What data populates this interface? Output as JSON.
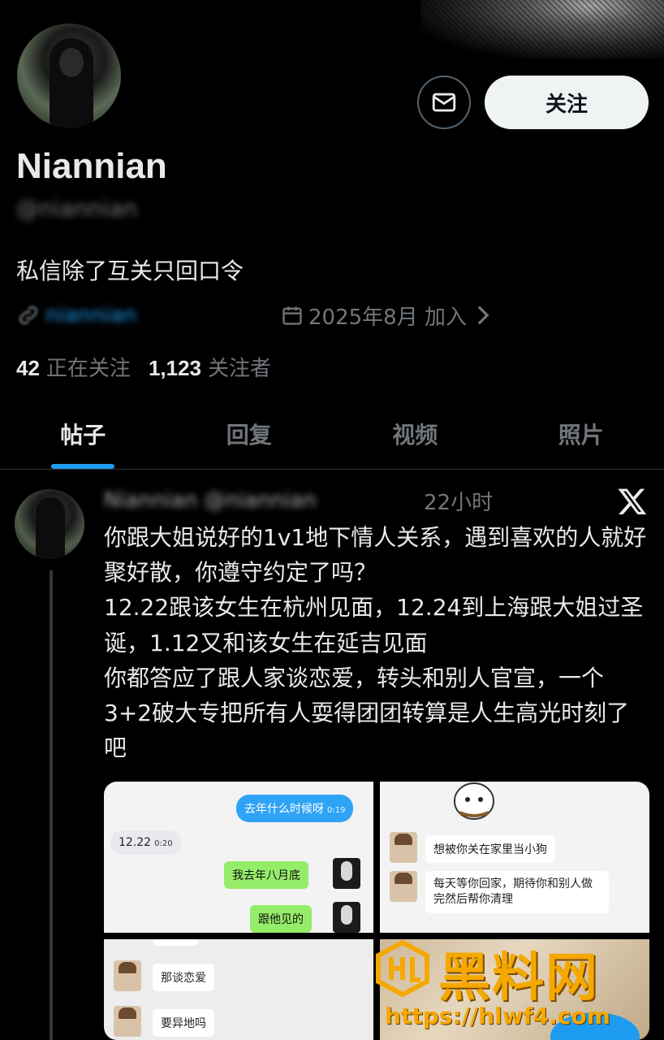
{
  "profile": {
    "display_name": "Niannian",
    "handle": "@niannian",
    "bio": "私信除了互关只回口令",
    "link_text": "niannian",
    "joined": "2025年8月 加入",
    "following_count": "42",
    "following_label": "正在关注",
    "followers_count": "1,123",
    "followers_label": "关注者",
    "follow_button": "关注"
  },
  "tabs": [
    {
      "label": "帖子",
      "active": true
    },
    {
      "label": "回复",
      "active": false
    },
    {
      "label": "视频",
      "active": false
    },
    {
      "label": "照片",
      "active": false
    }
  ],
  "post": {
    "author_blurred": "Niannian @niannian",
    "time": "22小时",
    "paragraphs": [
      "你跟大姐说好的1v1地下情人关系，遇到喜欢的人就好聚好散，你遵守约定了吗？",
      "12.22跟该女生在杭州见面，12.24到上海跟大姐过圣诞，1.12又和该女生在延吉见面",
      "你都答应了跟人家谈恋爱，转头和别人官宣，一个3+2破大专把所有人耍得团团转算是人生高光时刻了吧"
    ],
    "media": {
      "chat1": {
        "q": "去年什么时候呀",
        "q_time": "0:19",
        "a": "12.22",
        "a_time": "0:20",
        "m1": "我去年八月底",
        "m2": "跟他见的"
      },
      "chat2": {
        "m1": "想被你关在家里当小狗",
        "m2": "每天等你回家，期待你和别人做完然后帮你清理"
      },
      "chat3": {
        "m1": "那谈恋爱",
        "m2": "要异地吗"
      }
    }
  },
  "watermark": {
    "text": "黑料网",
    "url": "https://hlwf4.com"
  },
  "colors": {
    "background": "#000000",
    "accent": "#1d9bf0",
    "muted": "#71767b",
    "text": "#e7e9ea",
    "watermark": "#f5a800"
  }
}
